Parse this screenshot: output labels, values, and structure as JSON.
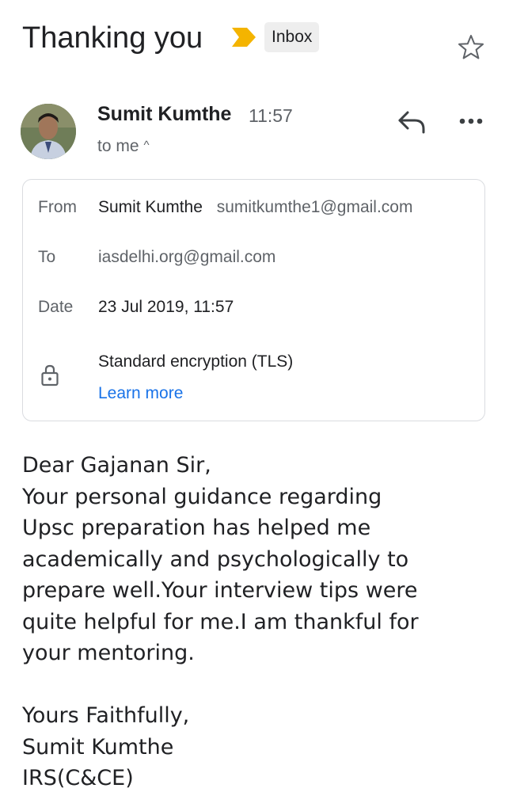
{
  "email": {
    "subject": "Thanking you",
    "label": "Inbox",
    "sender_name": "Sumit Kumthe",
    "time": "11:57",
    "recipient_summary": "to me",
    "details": {
      "from_label": "From",
      "from_name": "Sumit Kumthe",
      "from_email": "sumitkumthe1@gmail.com",
      "to_label": "To",
      "to_value": "iasdelhi.org@gmail.com",
      "date_label": "Date",
      "date_value": "23 Jul 2019, 11:57",
      "encryption": "Standard encryption (TLS)",
      "learn_more": "Learn more"
    },
    "body": {
      "lines": [
        "Dear Gajanan Sir,",
        "Your personal guidance regarding",
        "Upsc preparation has helped me",
        "academically and psychologically to",
        "prepare well.Your interview tips were",
        "quite helpful for me.I am thankful for",
        "your mentoring."
      ],
      "closing": [
        "Yours Faithfully,",
        "Sumit Kumthe",
        "IRS(C&CE)"
      ]
    }
  },
  "colors": {
    "importance": "#f4b400",
    "link": "#1a73e8",
    "secondary_text": "#5f6368",
    "border": "#dadce0"
  },
  "icons": {
    "importance": "importance-marker-icon",
    "star": "star-icon",
    "reply": "reply-icon",
    "more": "more-horizontal-icon",
    "lock": "lock-icon",
    "caret": "caret-up-icon"
  }
}
